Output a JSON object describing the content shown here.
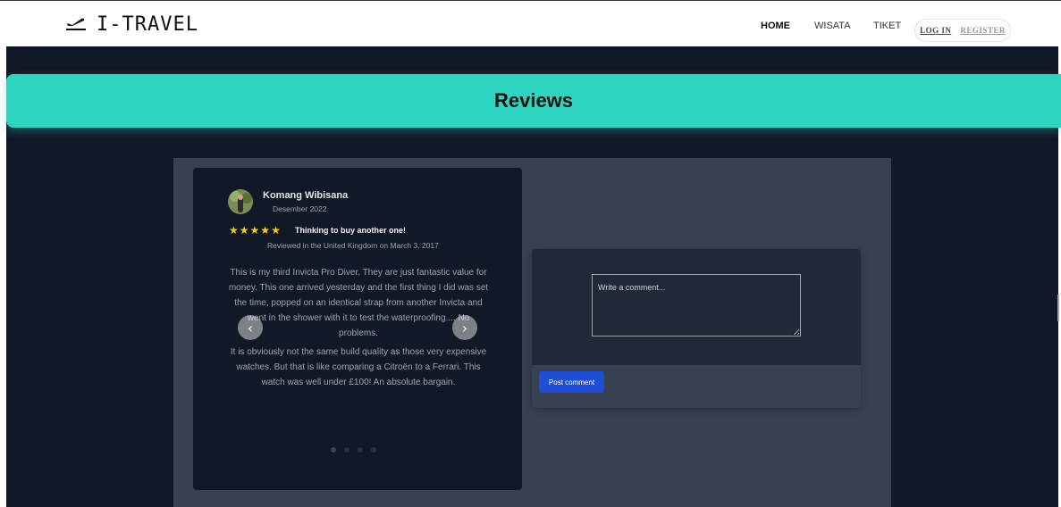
{
  "navbar": {
    "brand": "I-TRAVEL",
    "brand_icon": "plane-departure-icon",
    "links": [
      "HOME",
      "WISATA",
      "TIKET"
    ],
    "login": "LOG IN",
    "register": "REGISTER"
  },
  "banner": {
    "title": "Reviews",
    "color": "#2dd4bf"
  },
  "review": {
    "reviewer": "Komang Wibisana",
    "date": "Desember 2022",
    "rating": 5,
    "headline": "Thinking to buy another one!",
    "origin": "Reviewed in the United Kingdom on March 3, 2017",
    "body": [
      "This is my third Invicta Pro Diver. They are just fantastic value for money. This one arrived yesterday and the first thing I did was set the time, popped on an identical strap from another Invicta and went in the shower with it to test the waterproofing.... No problems.",
      "It is obviously not the same build quality as those very expensive watches. But that is like comparing a Citroën to a Ferrari. This watch was well under £100! An absolute bargain."
    ],
    "slide_count": 4,
    "active_slide": 1
  },
  "comment": {
    "placeholder": "Write a comment...",
    "value": "",
    "submit_label": "Post comment",
    "button_color": "#1d4ed8"
  },
  "colors": {
    "page_bg": "#111827",
    "panel_bg": "#374151",
    "card_bg": "#111827",
    "star": "#facc15"
  }
}
